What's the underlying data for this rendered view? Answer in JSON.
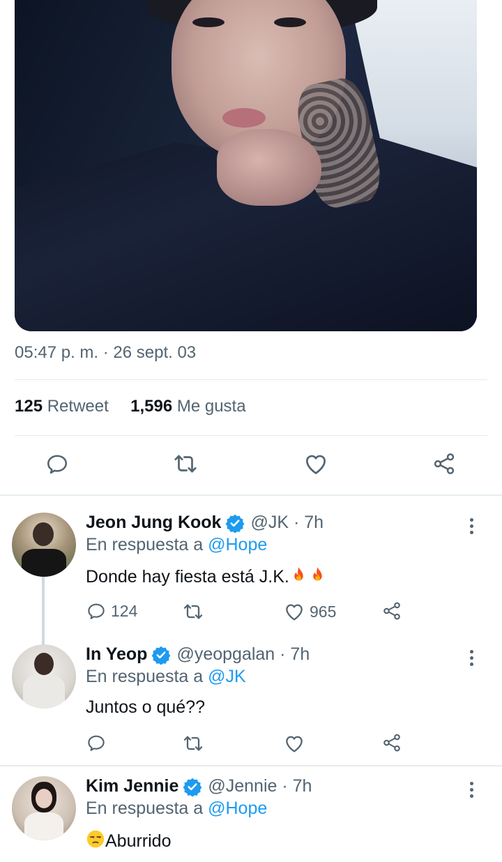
{
  "tweet": {
    "timestamp": "05:47 p. m. · 26 sept. 03",
    "retweets_count": "125",
    "retweets_label": "Retweet",
    "likes_count": "1,596",
    "likes_label": "Me gusta"
  },
  "replies": [
    {
      "name": "Jeon Jung Kook",
      "handle": "@JK · 7h",
      "in_reply_prefix": "En respuesta a",
      "in_reply_mention": "@Hope",
      "text": "Donde hay fiesta está J.K.",
      "reply_count": "124",
      "retweet_count": "",
      "like_count": "965"
    },
    {
      "name": "In Yeop",
      "handle": "@yeopgalan · 7h",
      "in_reply_prefix": "En respuesta a",
      "in_reply_mention": "@JK",
      "text": "Juntos o qué??",
      "reply_count": "",
      "retweet_count": "",
      "like_count": ""
    },
    {
      "name": "Kim Jennie",
      "handle": "@Jennie · 7h",
      "in_reply_prefix": "En respuesta a",
      "in_reply_mention": "@Hope",
      "text": "Aburrido"
    }
  ],
  "icons": {
    "reply": "reply-icon",
    "retweet": "retweet-icon",
    "like": "heart-icon",
    "share": "share-icon",
    "verified": "verified-badge-icon",
    "more": "more-vertical-icon",
    "fire": "fire-emoji",
    "unamused": "unamused-face-emoji"
  },
  "colors": {
    "accent": "#1d9bf0",
    "secondary_text": "#536471",
    "primary_text": "#0f1419"
  }
}
